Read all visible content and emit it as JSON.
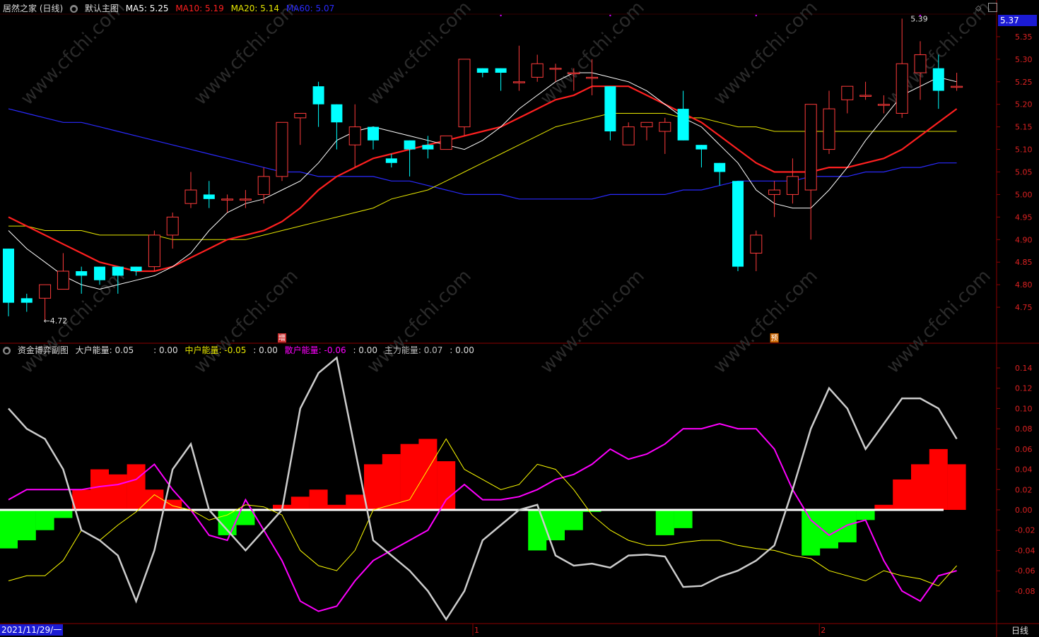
{
  "main_header": {
    "title": "居然之家 (日线)",
    "template": "默认主图",
    "ma5_label": "MA5:",
    "ma5_value": "5.25",
    "ma10_label": "MA10:",
    "ma10_value": "5.19",
    "ma20_label": "MA20:",
    "ma20_value": "5.14",
    "ma60_label": "MA60:",
    "ma60_value": "5.07"
  },
  "sub_header": {
    "title": "资金博弈副图",
    "big_label": "大户能量:",
    "big_value": "0.05",
    "big_extra": ": 0.00",
    "mid_label": "中户能量:",
    "mid_value": "-0.05",
    "mid_extra": ": 0.00",
    "small_label": "散户能量:",
    "small_value": "-0.06",
    "small_extra": ": 0.00",
    "main_label": "主力能量:",
    "main_value": "0.07",
    "main_extra": ": 0.00"
  },
  "last_price": "5.37",
  "date_label": "2021/11/29/一",
  "period_tab": "日线",
  "month_labels": [
    "1",
    "2"
  ],
  "markers": [
    "增",
    "预"
  ],
  "annotations": {
    "low": "4.72",
    "high": "5.39"
  },
  "watermark": "www.cfchi.com",
  "colors": {
    "up": "#ff3b3b",
    "down": "#00ffff",
    "ma5": "#ffffff",
    "ma10": "#ff2020",
    "ma20": "#e8e800",
    "ma60": "#2a2aff",
    "big": "#ff0000",
    "mid": "#ffff00",
    "small": "#ff00ff",
    "main": "#cccccc",
    "neg_bar": "#00ff00"
  },
  "chart_data": [
    {
      "type": "candlestick",
      "title": "居然之家 (日线)",
      "ylim": [
        4.7,
        5.4
      ],
      "yticks": [
        "5.35",
        "5.30",
        "5.25",
        "5.20",
        "5.15",
        "5.10",
        "5.05",
        "5.00",
        "4.95",
        "4.90",
        "4.85",
        "4.80",
        "4.75"
      ],
      "ohlc": [
        [
          4.88,
          4.88,
          4.73,
          4.76
        ],
        [
          4.77,
          4.78,
          4.74,
          4.76
        ],
        [
          4.77,
          4.8,
          4.72,
          4.8
        ],
        [
          4.79,
          4.87,
          4.79,
          4.83
        ],
        [
          4.83,
          4.84,
          4.78,
          4.82
        ],
        [
          4.84,
          4.84,
          4.8,
          4.81
        ],
        [
          4.84,
          4.84,
          4.78,
          4.82
        ],
        [
          4.84,
          4.84,
          4.82,
          4.83
        ],
        [
          4.84,
          4.92,
          4.83,
          4.91
        ],
        [
          4.91,
          4.96,
          4.88,
          4.95
        ],
        [
          4.98,
          5.05,
          4.97,
          5.01
        ],
        [
          5.0,
          5.03,
          4.97,
          4.99
        ],
        [
          4.99,
          5.0,
          4.96,
          4.99
        ],
        [
          4.99,
          5.01,
          4.97,
          4.99
        ],
        [
          5.0,
          5.06,
          4.98,
          5.04
        ],
        [
          5.04,
          5.12,
          5.03,
          5.16
        ],
        [
          5.17,
          5.17,
          5.11,
          5.18
        ],
        [
          5.24,
          5.25,
          5.15,
          5.2
        ],
        [
          5.2,
          5.2,
          5.1,
          5.16
        ],
        [
          5.11,
          5.2,
          5.06,
          5.15
        ],
        [
          5.15,
          5.15,
          5.1,
          5.12
        ],
        [
          5.08,
          5.09,
          5.06,
          5.07
        ],
        [
          5.12,
          5.12,
          5.04,
          5.1
        ],
        [
          5.11,
          5.13,
          5.08,
          5.1
        ],
        [
          5.1,
          5.13,
          5.1,
          5.13
        ],
        [
          5.15,
          5.24,
          5.13,
          5.3
        ],
        [
          5.28,
          5.28,
          5.26,
          5.27
        ],
        [
          5.28,
          5.28,
          5.23,
          5.27
        ],
        [
          5.25,
          5.33,
          5.23,
          5.25
        ],
        [
          5.26,
          5.31,
          5.25,
          5.29
        ],
        [
          5.28,
          5.29,
          5.25,
          5.28
        ],
        [
          5.27,
          5.28,
          5.23,
          5.27
        ],
        [
          5.26,
          5.3,
          5.22,
          5.26
        ],
        [
          5.24,
          5.24,
          5.12,
          5.14
        ],
        [
          5.11,
          5.16,
          5.11,
          5.15
        ],
        [
          5.15,
          5.16,
          5.12,
          5.16
        ],
        [
          5.14,
          5.17,
          5.09,
          5.16
        ],
        [
          5.19,
          5.23,
          5.12,
          5.12
        ],
        [
          5.11,
          5.11,
          5.06,
          5.1
        ],
        [
          5.07,
          5.07,
          5.02,
          5.05
        ],
        [
          5.03,
          5.03,
          4.83,
          4.84
        ],
        [
          4.87,
          4.92,
          4.83,
          4.91
        ],
        [
          5.0,
          5.03,
          4.95,
          5.01
        ],
        [
          5.0,
          5.08,
          4.98,
          5.04
        ],
        [
          5.01,
          5.12,
          4.9,
          5.2
        ],
        [
          5.1,
          5.23,
          5.09,
          5.19
        ],
        [
          5.21,
          5.23,
          5.18,
          5.24
        ],
        [
          5.22,
          5.25,
          5.21,
          5.22
        ],
        [
          5.2,
          5.22,
          5.18,
          5.2
        ],
        [
          5.18,
          5.39,
          5.17,
          5.29
        ],
        [
          5.27,
          5.34,
          5.21,
          5.31
        ],
        [
          5.28,
          5.31,
          5.19,
          5.23
        ],
        [
          5.24,
          5.27,
          5.23,
          5.24
        ]
      ],
      "ma5": [
        4.92,
        4.88,
        4.85,
        4.82,
        4.8,
        4.79,
        4.8,
        4.81,
        4.82,
        4.84,
        4.87,
        4.92,
        4.96,
        4.98,
        4.99,
        5.01,
        5.03,
        5.07,
        5.12,
        5.14,
        5.15,
        5.14,
        5.13,
        5.12,
        5.11,
        5.1,
        5.12,
        5.15,
        5.19,
        5.22,
        5.25,
        5.27,
        5.27,
        5.26,
        5.25,
        5.23,
        5.2,
        5.17,
        5.15,
        5.11,
        5.07,
        5.01,
        4.98,
        4.97,
        4.97,
        5.01,
        5.06,
        5.12,
        5.17,
        5.22,
        5.24,
        5.26,
        5.25
      ],
      "ma10": [
        4.95,
        4.93,
        4.91,
        4.89,
        4.87,
        4.85,
        4.84,
        4.83,
        4.83,
        4.84,
        4.86,
        4.88,
        4.9,
        4.91,
        4.92,
        4.94,
        4.97,
        5.01,
        5.04,
        5.06,
        5.08,
        5.09,
        5.1,
        5.11,
        5.12,
        5.13,
        5.14,
        5.15,
        5.17,
        5.19,
        5.21,
        5.22,
        5.24,
        5.24,
        5.24,
        5.22,
        5.2,
        5.18,
        5.16,
        5.13,
        5.1,
        5.07,
        5.05,
        5.05,
        5.05,
        5.06,
        5.06,
        5.07,
        5.08,
        5.1,
        5.13,
        5.16,
        5.19
      ],
      "ma20": [
        4.93,
        4.93,
        4.92,
        4.92,
        4.92,
        4.91,
        4.91,
        4.91,
        4.91,
        4.9,
        4.9,
        4.9,
        4.9,
        4.9,
        4.91,
        4.92,
        4.93,
        4.94,
        4.95,
        4.96,
        4.97,
        4.99,
        5.0,
        5.01,
        5.03,
        5.05,
        5.07,
        5.09,
        5.11,
        5.13,
        5.15,
        5.16,
        5.17,
        5.18,
        5.18,
        5.18,
        5.18,
        5.17,
        5.17,
        5.16,
        5.15,
        5.15,
        5.14,
        5.14,
        5.14,
        5.14,
        5.14,
        5.14,
        5.14,
        5.14,
        5.14,
        5.14,
        5.14
      ],
      "ma60": [
        5.19,
        5.18,
        5.17,
        5.16,
        5.16,
        5.15,
        5.14,
        5.13,
        5.12,
        5.11,
        5.1,
        5.09,
        5.08,
        5.07,
        5.06,
        5.05,
        5.05,
        5.04,
        5.04,
        5.04,
        5.04,
        5.03,
        5.03,
        5.02,
        5.01,
        5.0,
        5.0,
        5.0,
        4.99,
        4.99,
        4.99,
        4.99,
        4.99,
        5.0,
        5.0,
        5.0,
        5.0,
        5.01,
        5.01,
        5.02,
        5.03,
        5.03,
        5.03,
        5.03,
        5.04,
        5.04,
        5.04,
        5.05,
        5.05,
        5.06,
        5.06,
        5.07,
        5.07
      ]
    },
    {
      "type": "bar+line",
      "title": "资金博弈副图",
      "ylim": [
        -0.11,
        0.15
      ],
      "yticks": [
        "0.14",
        "0.12",
        "0.10",
        "0.08",
        "0.06",
        "0.04",
        "0.02",
        "0.00",
        "-0.02",
        "-0.04",
        "-0.06",
        "-0.08"
      ],
      "bars": [
        -0.038,
        -0.03,
        -0.02,
        -0.008,
        0.02,
        0.04,
        0.035,
        0.045,
        0.02,
        0.01,
        0,
        0,
        -0.025,
        -0.015,
        0,
        0.005,
        0.013,
        0.02,
        0.005,
        0.015,
        0.045,
        0.055,
        0.065,
        0.07,
        0.048,
        0,
        0,
        0,
        0,
        -0.04,
        -0.03,
        -0.02,
        -0.002,
        0,
        0,
        0,
        -0.025,
        -0.018,
        0,
        0,
        0,
        0,
        0,
        0,
        -0.045,
        -0.038,
        -0.032,
        -0.01,
        0.005,
        0.03,
        0.045,
        0.06,
        0.045
      ],
      "series": [
        {
          "name": "大户能量",
          "values": [
            0.01,
            0.02,
            0.02,
            0.02,
            0.02,
            0.023,
            0.025,
            0.03,
            0.045,
            0.02,
            0.0,
            -0.025,
            -0.03,
            0.01,
            -0.02,
            -0.05,
            -0.09,
            -0.1,
            -0.095,
            -0.07,
            -0.05,
            -0.04,
            -0.03,
            -0.02,
            0.01,
            0.025,
            0.01,
            0.01,
            0.013,
            0.02,
            0.03,
            0.035,
            0.045,
            0.06,
            0.05,
            0.055,
            0.065,
            0.08,
            0.08,
            0.085,
            0.08,
            0.08,
            0.06,
            0.02,
            -0.01,
            -0.025,
            -0.015,
            -0.01,
            -0.05,
            -0.08,
            -0.09,
            -0.065,
            -0.06
          ]
        },
        {
          "name": "中户能量",
          "values": [
            -0.07,
            -0.065,
            -0.065,
            -0.05,
            -0.02,
            -0.03,
            -0.015,
            -0.002,
            0.015,
            0.004,
            0.0,
            -0.01,
            -0.005,
            0.005,
            0.003,
            -0.005,
            -0.04,
            -0.055,
            -0.06,
            -0.04,
            0.0,
            0.005,
            0.01,
            0.04,
            0.07,
            0.04,
            0.03,
            0.02,
            0.025,
            0.045,
            0.04,
            0.02,
            -0.005,
            -0.02,
            -0.03,
            -0.035,
            -0.035,
            -0.032,
            -0.03,
            -0.03,
            -0.035,
            -0.038,
            -0.04,
            -0.045,
            -0.048,
            -0.06,
            -0.065,
            -0.07,
            -0.06,
            -0.065,
            -0.068,
            -0.075,
            -0.055
          ]
        },
        {
          "name": "散户能量",
          "values": [
            -0.055,
            -0.045,
            -0.04,
            -0.02,
            0.02,
            0.015,
            0.01,
            0.02,
            0.03,
            0.04,
            0.0,
            -0.005,
            -0.01,
            0.015,
            0.03,
            0.025,
            0.015,
            0.02,
            0.005,
            0.01,
            0.02,
            0.025,
            0.03,
            0.03,
            0.035,
            0.01,
            0.005,
            -0.01,
            -0.02,
            -0.03,
            -0.045,
            -0.042,
            -0.035,
            -0.02,
            -0.03,
            -0.03,
            -0.022,
            -0.02,
            -0.02,
            -0.02,
            -0.02,
            -0.02,
            -0.02,
            -0.02,
            -0.02,
            -0.018,
            -0.012,
            -0.015,
            -0.02,
            -0.03,
            -0.02,
            -0.035,
            -0.02
          ]
        },
        {
          "name": "主力能量",
          "values": [
            0.1,
            0.08,
            0.07,
            0.04,
            -0.02,
            -0.03,
            -0.045,
            -0.09,
            -0.04,
            0.04,
            0.065,
            0.0,
            -0.02,
            -0.04,
            -0.02,
            0.0,
            0.1,
            0.135,
            0.15,
            0.06,
            -0.03,
            -0.045,
            -0.06,
            -0.08,
            -0.108,
            -0.08,
            -0.03,
            -0.015,
            0.0,
            0.005,
            -0.045,
            -0.055,
            -0.053,
            -0.057,
            -0.045,
            -0.044,
            -0.046,
            -0.076,
            -0.075,
            -0.066,
            -0.06,
            -0.05,
            -0.035,
            0.02,
            0.08,
            0.12,
            0.1,
            0.06,
            0.085,
            0.11,
            0.11,
            0.1,
            0.07
          ]
        }
      ]
    }
  ]
}
